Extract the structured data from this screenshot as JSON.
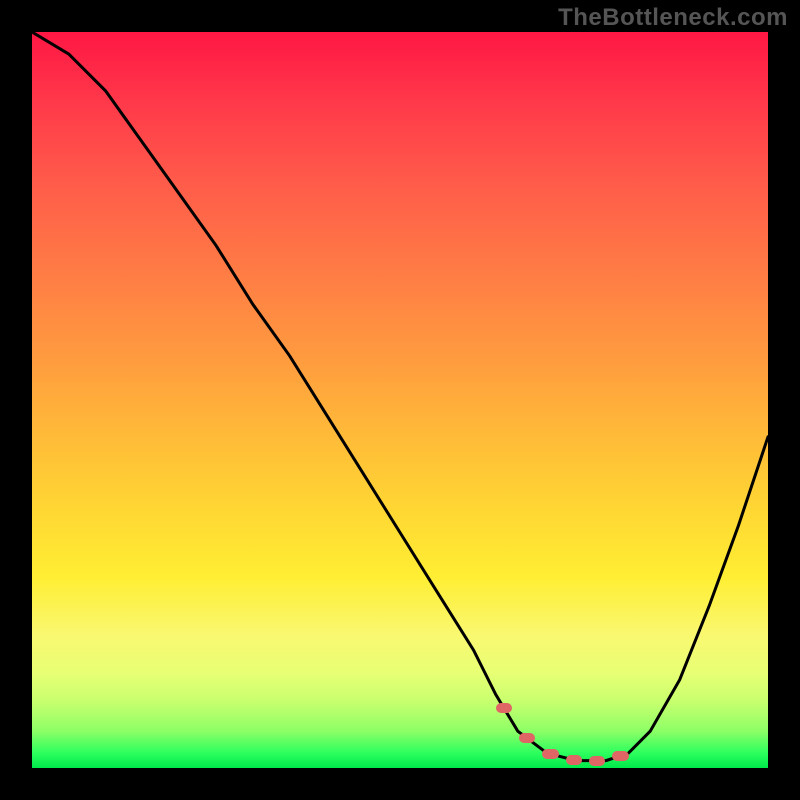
{
  "watermark": "TheBottleneck.com",
  "colors": {
    "background": "#000000",
    "gradient_top": "#ff1744",
    "gradient_mid": "#ffd733",
    "gradient_bottom": "#00e84a",
    "curve": "#000000",
    "highlight": "#e06666"
  },
  "chart_data": {
    "type": "line",
    "title": "",
    "xlabel": "",
    "ylabel": "",
    "xlim": [
      0,
      100
    ],
    "ylim": [
      0,
      100
    ],
    "grid": false,
    "legend": false,
    "series": [
      {
        "name": "bottleneck-curve",
        "x": [
          0,
          5,
          10,
          15,
          20,
          25,
          30,
          35,
          40,
          45,
          50,
          55,
          60,
          63,
          66,
          70,
          74,
          78,
          81,
          84,
          88,
          92,
          96,
          100
        ],
        "values": [
          100,
          97,
          92,
          85,
          78,
          71,
          63,
          56,
          48,
          40,
          32,
          24,
          16,
          10,
          5,
          2,
          1,
          1,
          2,
          5,
          12,
          22,
          33,
          45
        ]
      }
    ],
    "highlight_range": {
      "from": 63,
      "to": 82,
      "near_y": 1
    },
    "annotations": []
  }
}
